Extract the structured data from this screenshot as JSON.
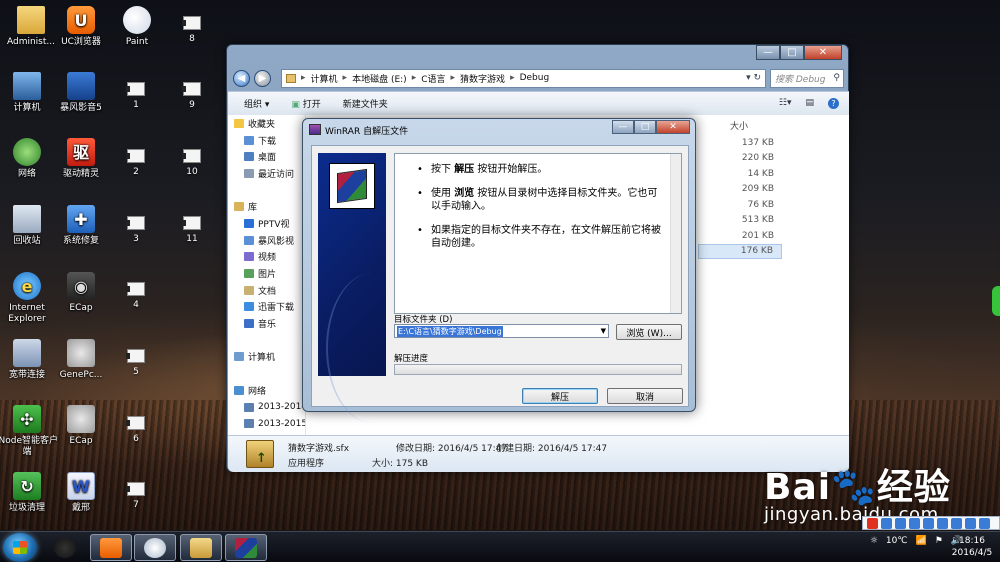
{
  "desktop": {
    "icons": [
      {
        "label": "Administ...",
        "icon": "user-folder-icon"
      },
      {
        "label": "UC浏览器",
        "icon": "uc-browser-icon"
      },
      {
        "label": "Paint",
        "icon": "paint-icon"
      },
      {
        "label": "计算机",
        "icon": "computer-icon"
      },
      {
        "label": "暴风影音5",
        "icon": "baofeng-icon"
      },
      {
        "label": "网络",
        "icon": "network-icon"
      },
      {
        "label": "驱动精灵",
        "icon": "driver-genius-icon"
      },
      {
        "label": "回收站",
        "icon": "recycle-bin-icon"
      },
      {
        "label": "系统修复",
        "icon": "system-repair-icon"
      },
      {
        "label": "Internet Explorer",
        "icon": "ie-icon"
      },
      {
        "label": "ECap",
        "icon": "camera-icon"
      },
      {
        "label": "宽带连接",
        "icon": "broadband-icon"
      },
      {
        "label": "GenePc...",
        "icon": "genepc-icon"
      },
      {
        "label": "iNode智能客户端",
        "icon": "inode-icon"
      },
      {
        "label": "ECap",
        "icon": "ecap-icon"
      },
      {
        "label": "垃圾清理",
        "icon": "cleanup-icon"
      },
      {
        "label": "戴邢",
        "icon": "word-doc-icon"
      }
    ],
    "files": [
      "8",
      "1",
      "9",
      "2",
      "10",
      "3",
      "11",
      "4",
      "5",
      "6",
      "7"
    ]
  },
  "explorer": {
    "window_controls": [
      "—",
      "□",
      "✕"
    ],
    "breadcrumb": [
      "计算机",
      "本地磁盘 (E:)",
      "C语言",
      "猜数字游戏",
      "Debug"
    ],
    "search_placeholder": "搜索 Debug",
    "toolbar": {
      "organize": "组织 ▾",
      "open": "打开",
      "new_folder": "新建文件夹"
    },
    "nav": [
      {
        "label": "收藏夹",
        "header": true,
        "icon": "star-icon"
      },
      {
        "label": "下载",
        "icon": "download-folder-icon"
      },
      {
        "label": "桌面",
        "icon": "desktop-icon"
      },
      {
        "label": "最近访问",
        "icon": "recent-icon"
      },
      {
        "label": "",
        "icon": ""
      },
      {
        "label": "库",
        "header": true,
        "icon": "library-icon"
      },
      {
        "label": "PPTV视",
        "icon": "pptv-icon"
      },
      {
        "label": "暴风影视",
        "icon": "video-lib-icon"
      },
      {
        "label": "视频",
        "icon": "video-icon"
      },
      {
        "label": "图片",
        "icon": "picture-icon"
      },
      {
        "label": "文档",
        "icon": "document-icon"
      },
      {
        "label": "迅雷下载",
        "icon": "thunder-icon"
      },
      {
        "label": "音乐",
        "icon": "music-icon"
      },
      {
        "label": "",
        "icon": ""
      },
      {
        "label": "计算机",
        "header": true,
        "icon": "computer-icon"
      },
      {
        "label": "",
        "icon": ""
      },
      {
        "label": "网络",
        "header": true,
        "icon": "network-icon"
      },
      {
        "label": "2013-20141108",
        "icon": "net-computer-icon"
      },
      {
        "label": "2013-20150721",
        "icon": "net-computer-icon"
      }
    ],
    "size_header": "大小",
    "sizes": [
      "137 KB",
      "220 KB",
      "14 KB",
      "209 KB",
      "76 KB",
      "513 KB",
      "201 KB",
      "176 KB"
    ],
    "details": {
      "name": "猜数字游戏.sfx",
      "modified": "修改日期: 2016/4/5 17:47",
      "created": "创建日期: 2016/4/5 17:47",
      "type": "应用程序",
      "size": "大小: 175 KB"
    }
  },
  "winrar": {
    "title": "WinRAR 自解压文件",
    "messages": [
      [
        "按下 ",
        "解压",
        " 按钮开始解压。"
      ],
      [
        "使用 ",
        "浏览",
        " 按钮从目录树中选择目标文件夹。它也可以手动输入。"
      ],
      [
        "如果指定的目标文件夹不存在，在文件解压前它将被自动创建。",
        "",
        ""
      ]
    ],
    "dest_label": "目标文件夹 (D)",
    "dest_value": "E:\\C语言\\猜数字游戏\\Debug",
    "browse": "浏览 (W)...",
    "progress_label": "解压进度",
    "progress": 0,
    "extract": "解压",
    "cancel": "取消"
  },
  "taskbar": {
    "apps": [
      "qq-icon",
      "uc-browser-icon",
      "paint-icon",
      "explorer-icon",
      "winrar-icon"
    ],
    "temp": "10℃",
    "time": "18:16",
    "date": "2016/4/5"
  },
  "watermark": {
    "brand": "Bai",
    "brand_cn": "经验",
    "url": "jingyan.baidu.com"
  }
}
